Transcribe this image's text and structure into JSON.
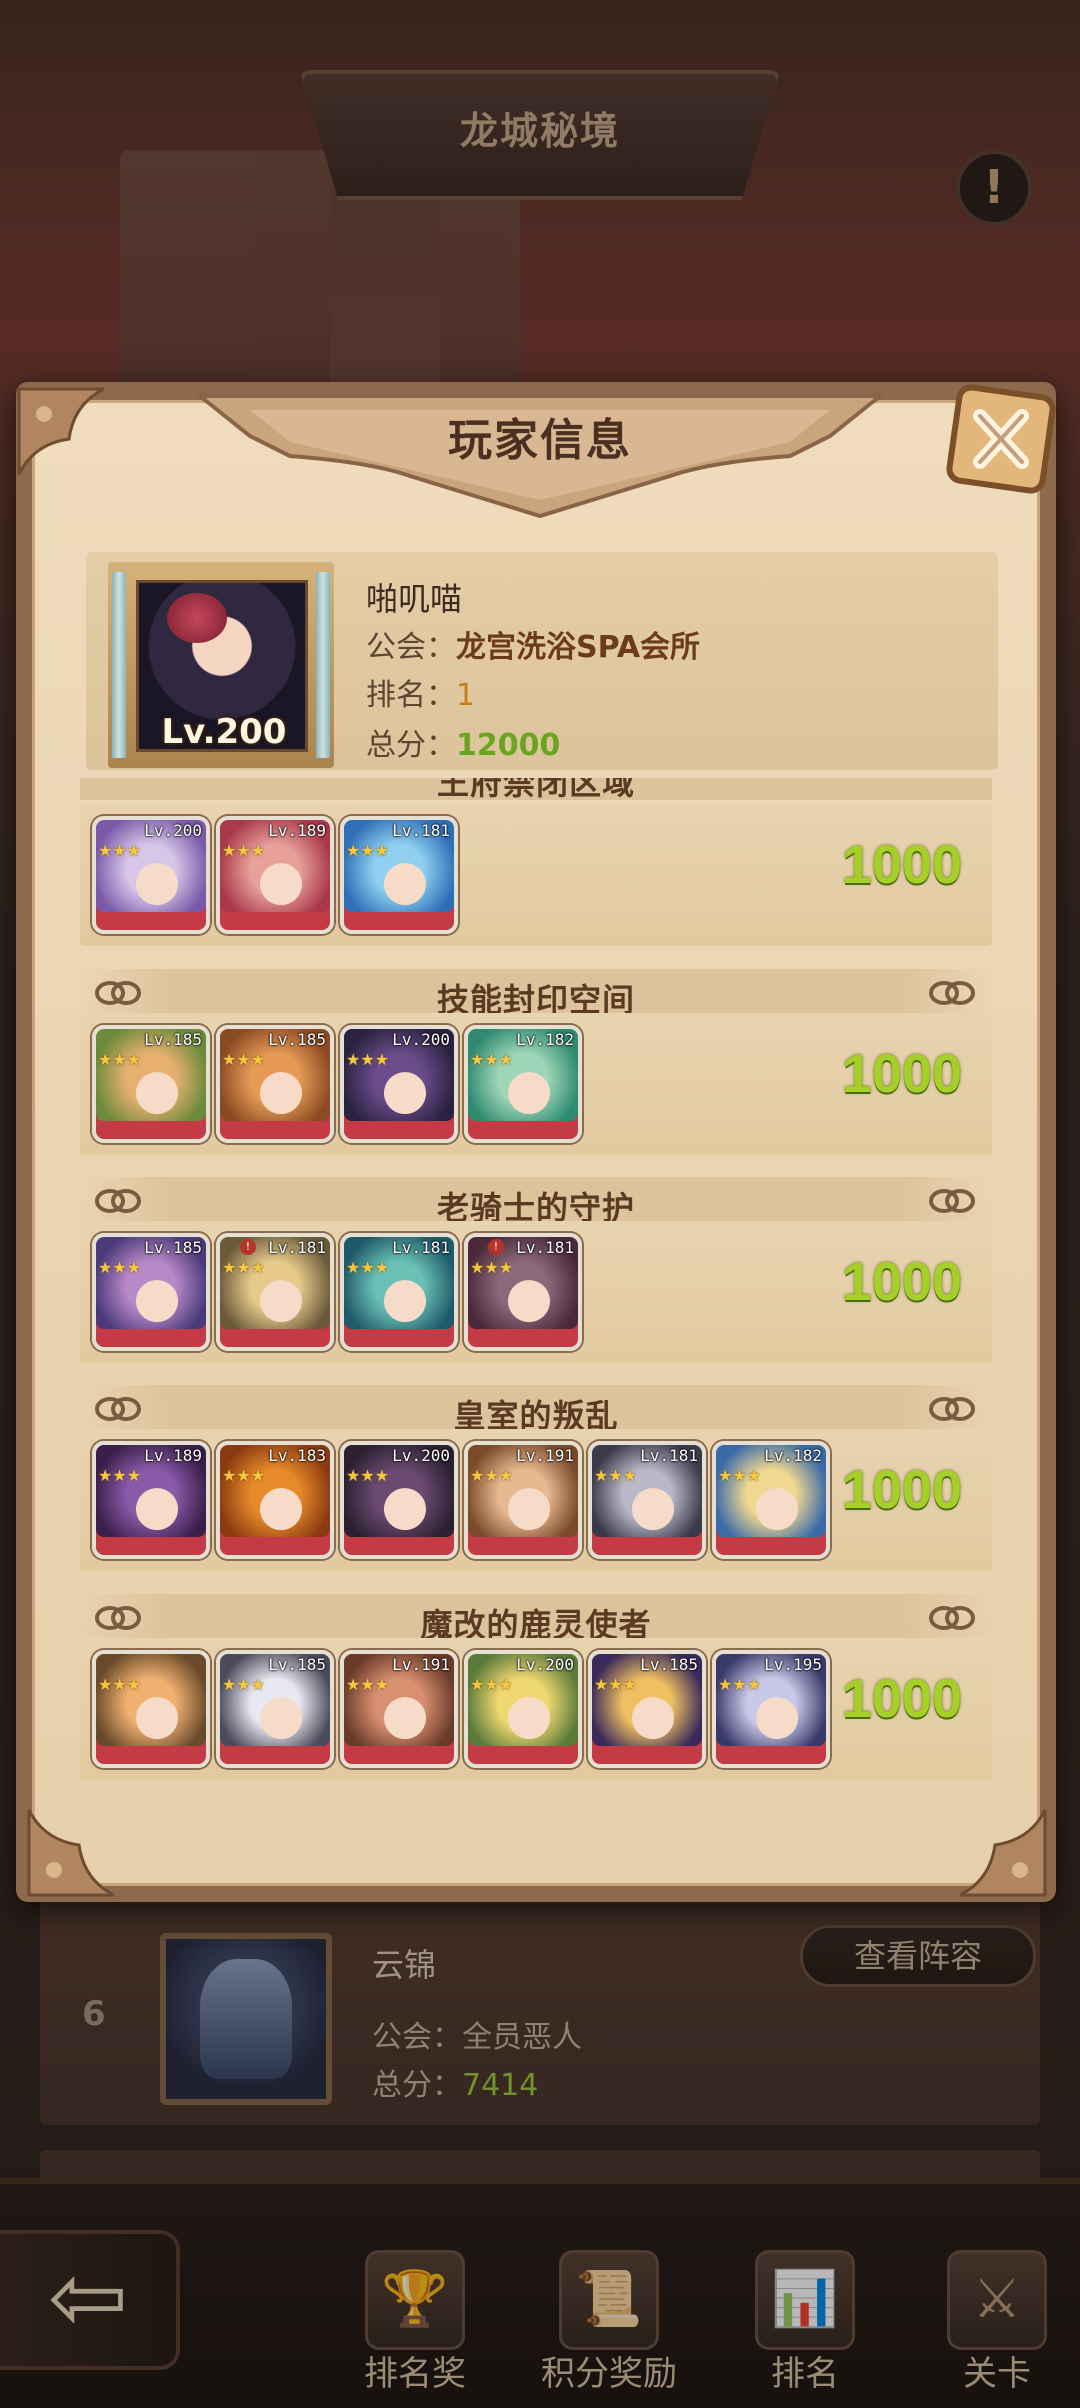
{
  "scene": {
    "title": "龙城秘境",
    "info_icon": "exclamation-icon"
  },
  "ranking_list": {
    "entry": {
      "rank": "6",
      "name": "云锦",
      "guild_label": "公会：",
      "guild": "全员恶人",
      "score_label": "总分：",
      "score": "7414",
      "view_button": "查看阵容"
    }
  },
  "bottom_nav": {
    "back_icon": "back-arrow-icon",
    "items": [
      {
        "label": "排名奖",
        "icon": "rank-reward-icon"
      },
      {
        "label": "积分奖励",
        "icon": "points-reward-icon"
      },
      {
        "label": "排名",
        "icon": "ranking-icon"
      },
      {
        "label": "关卡",
        "icon": "stage-icon"
      }
    ]
  },
  "modal": {
    "title": "玩家信息",
    "close_icon": "close-icon",
    "player": {
      "name": "啪叽喵",
      "level": "Lv.200",
      "guild_label": "公会：",
      "guild": "龙宫洗浴SPA会所",
      "rank_label": "排名：",
      "rank": "1",
      "score_label": "总分：",
      "score": "12000"
    },
    "teams": [
      {
        "name": "王府禁闭区域",
        "score": "1000",
        "heroes": [
          {
            "level": "Lv.200",
            "stars": "★★★",
            "colors": [
              "#7a5aa8",
              "#d7c6e8"
            ]
          },
          {
            "level": "Lv.189",
            "stars": "★★★",
            "colors": [
              "#a8384a",
              "#e7a09a"
            ]
          },
          {
            "level": "Lv.181",
            "stars": "★★★",
            "colors": [
              "#2f6fb6",
              "#8fd0f0"
            ]
          }
        ]
      },
      {
        "name": "技能封印空间",
        "score": "1000",
        "heroes": [
          {
            "level": "Lv.185",
            "stars": "★★★",
            "colors": [
              "#6b8a3a",
              "#e7b070"
            ]
          },
          {
            "level": "Lv.185",
            "stars": "★★★",
            "colors": [
              "#8a4a22",
              "#e69a55"
            ]
          },
          {
            "level": "Lv.200",
            "stars": "★★★",
            "colors": [
              "#2a2240",
              "#6a4c8a"
            ]
          },
          {
            "level": "Lv.182",
            "stars": "★★★",
            "colors": [
              "#2f8a70",
              "#9ed6b8"
            ]
          }
        ]
      },
      {
        "name": "老骑士的守护",
        "score": "1000",
        "heroes": [
          {
            "level": "Lv.185",
            "stars": "★★★",
            "colors": [
              "#4a3a7a",
              "#b889c8"
            ]
          },
          {
            "level": "Lv.181",
            "stars": "★★★",
            "colors": [
              "#6a5a3a",
              "#e7c98a"
            ],
            "flag": "!"
          },
          {
            "level": "Lv.181",
            "stars": "★★★",
            "colors": [
              "#1f5a6a",
              "#6ac0b4"
            ]
          },
          {
            "level": "Lv.181",
            "stars": "★★★",
            "colors": [
              "#4a2a3a",
              "#8a6a7a"
            ],
            "flag": "!"
          }
        ]
      },
      {
        "name": "皇室的叛乱",
        "score": "1000",
        "heroes": [
          {
            "level": "Lv.189",
            "stars": "★★★",
            "colors": [
              "#3a1f4a",
              "#8a5aa8"
            ]
          },
          {
            "level": "Lv.183",
            "stars": "★★★",
            "colors": [
              "#8a3a10",
              "#e78a2a"
            ]
          },
          {
            "level": "Lv.200",
            "stars": "★★★",
            "colors": [
              "#2a2030",
              "#6a4a70"
            ]
          },
          {
            "level": "Lv.191",
            "stars": "★★★",
            "colors": [
              "#7a4a2a",
              "#e8b890"
            ]
          },
          {
            "level": "Lv.181",
            "stars": "★★★",
            "colors": [
              "#3a3a4a",
              "#b8b8c8"
            ]
          },
          {
            "level": "Lv.182",
            "stars": "★★★",
            "colors": [
              "#3a6aa8",
              "#f0d890"
            ]
          }
        ]
      },
      {
        "name": "魔改的鹿灵使者",
        "score": "1000",
        "heroes": [
          {
            "level": "",
            "stars": "★★★",
            "colors": [
              "#6a4a2a",
              "#f0b070"
            ]
          },
          {
            "level": "Lv.185",
            "stars": "★★★",
            "colors": [
              "#4a4a5a",
              "#e8e8f0"
            ]
          },
          {
            "level": "Lv.191",
            "stars": "★★★",
            "colors": [
              "#6a3a2a",
              "#d89070"
            ]
          },
          {
            "level": "Lv.200",
            "stars": "★★★",
            "colors": [
              "#5a7a3a",
              "#f0d870"
            ]
          },
          {
            "level": "Lv.185",
            "stars": "★★★",
            "colors": [
              "#3a2a5a",
              "#f0c060"
            ]
          },
          {
            "level": "Lv.195",
            "stars": "★★★",
            "colors": [
              "#3a3a6a",
              "#c8c8e8"
            ]
          }
        ]
      }
    ]
  }
}
